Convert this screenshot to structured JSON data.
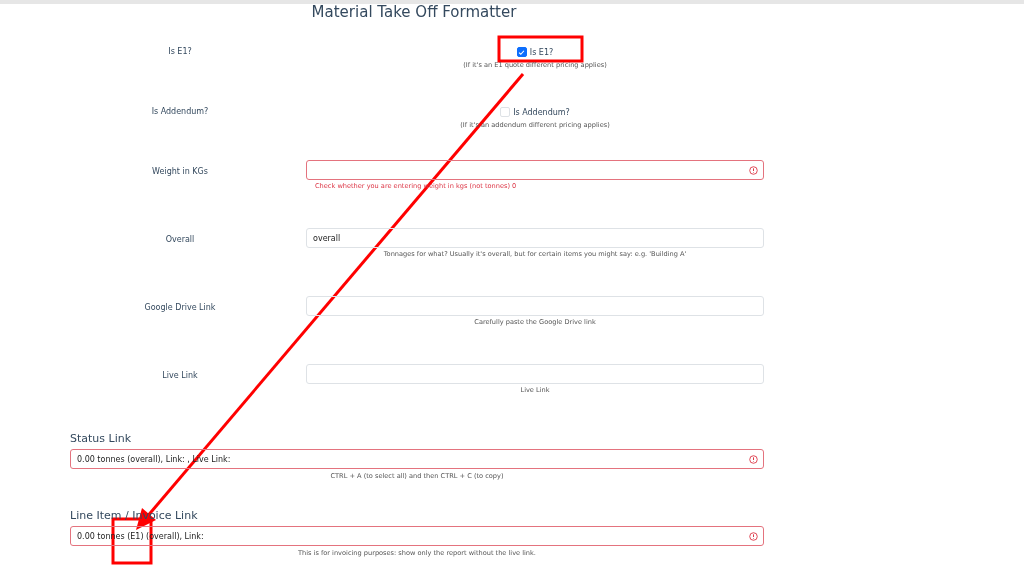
{
  "title": "Material Take Off Formatter",
  "rows": [
    {
      "kind": "checkbox",
      "label": "Is E1?",
      "option": "Is E1?",
      "checked": true,
      "help": {
        "text": "(If it's an E1 quote different pricing applies)",
        "kind": "hint"
      }
    },
    {
      "kind": "checkbox",
      "label": "Is Addendum?",
      "option": "Is Addendum?",
      "checked": false,
      "help": {
        "text": "(If it's an addendum different pricing applies)",
        "kind": "hint"
      }
    },
    {
      "kind": "input",
      "label": "Weight in KGs",
      "value": "",
      "invalid": true,
      "help": {
        "text": "Check whether you are entering weight in kgs (not tonnes) 0",
        "kind": "error"
      }
    },
    {
      "kind": "input",
      "label": "Overall",
      "value": "overall",
      "invalid": false,
      "help": {
        "text": "Tonnages for what? Usually it's overall, but for certain items you might say: e.g. 'Building A'",
        "kind": "hint"
      }
    },
    {
      "kind": "input",
      "label": "Google Drive Link",
      "value": "",
      "invalid": false,
      "help": {
        "text": "Carefully paste the Google Drive link",
        "kind": "hint"
      }
    },
    {
      "kind": "input",
      "label": "Live Link",
      "value": "",
      "invalid": false,
      "help": {
        "text": "Live Link",
        "kind": "hint"
      }
    }
  ],
  "sections": [
    {
      "heading": "Status Link",
      "value": "0.00 tonnes (overall), Link: , Live Link:",
      "invalid": true,
      "help": {
        "text": "CTRL + A (to select all) and then CTRL + C (to copy)",
        "kind": "hint"
      }
    },
    {
      "heading": "Line Item / Invoice Link",
      "value": "0.00 tonnes (E1) (overall), Link:",
      "invalid": true,
      "help": {
        "text": "This is for invoicing purposes: show only the report without the live link.",
        "kind": "hint"
      }
    }
  ]
}
